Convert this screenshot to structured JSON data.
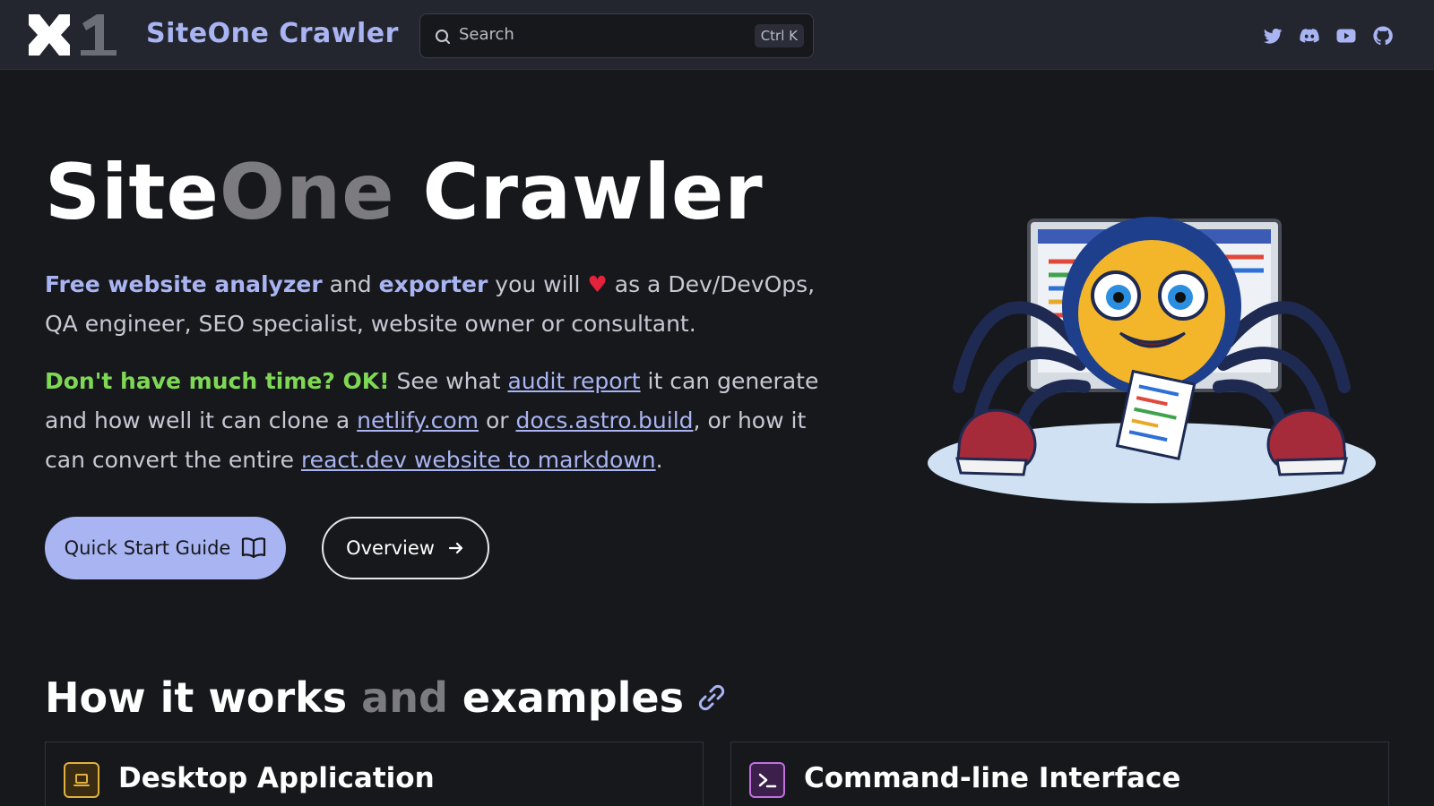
{
  "header": {
    "site_title": "SiteOne Crawler",
    "search": {
      "placeholder": "Search",
      "shortcut": "Ctrl K"
    },
    "social": [
      "twitter-icon",
      "discord-icon",
      "youtube-icon",
      "github-icon"
    ]
  },
  "hero": {
    "title_part1": "Site",
    "title_part2": "One",
    "title_part3": " Crawler",
    "tagline": {
      "bold1": "Free website analyzer",
      "text1": " and ",
      "bold2": "exporter",
      "text2": " you will ",
      "heart": "♥",
      "text3": " as a Dev/DevOps, QA engineer, SEO specialist, website owner or consultant."
    },
    "para2": {
      "green": "Don't have much time? OK!",
      "text1": " See what ",
      "link1": "audit report",
      "text2": " it can generate and how well it can clone a ",
      "link2": "netlify.com",
      "text3": " or ",
      "link3": "docs.astro.build",
      "text4": ", or how it can convert the entire ",
      "link4": "react.dev website to markdown",
      "text5": "."
    },
    "buttons": {
      "primary": "Quick Start Guide",
      "secondary": "Overview"
    }
  },
  "section": {
    "title_part1": "How it works",
    "title_part2": " and ",
    "title_part3": "examples",
    "cards": [
      {
        "title": "Desktop Application",
        "icon": "laptop-icon",
        "color": "#e0b040"
      },
      {
        "title": "Command-line Interface",
        "icon": "terminal-icon",
        "color": "#c070e0"
      }
    ]
  },
  "colors": {
    "accent": "#a9b4f2",
    "green": "#7fd855",
    "heart": "#e2233b",
    "background": "#17181c"
  }
}
